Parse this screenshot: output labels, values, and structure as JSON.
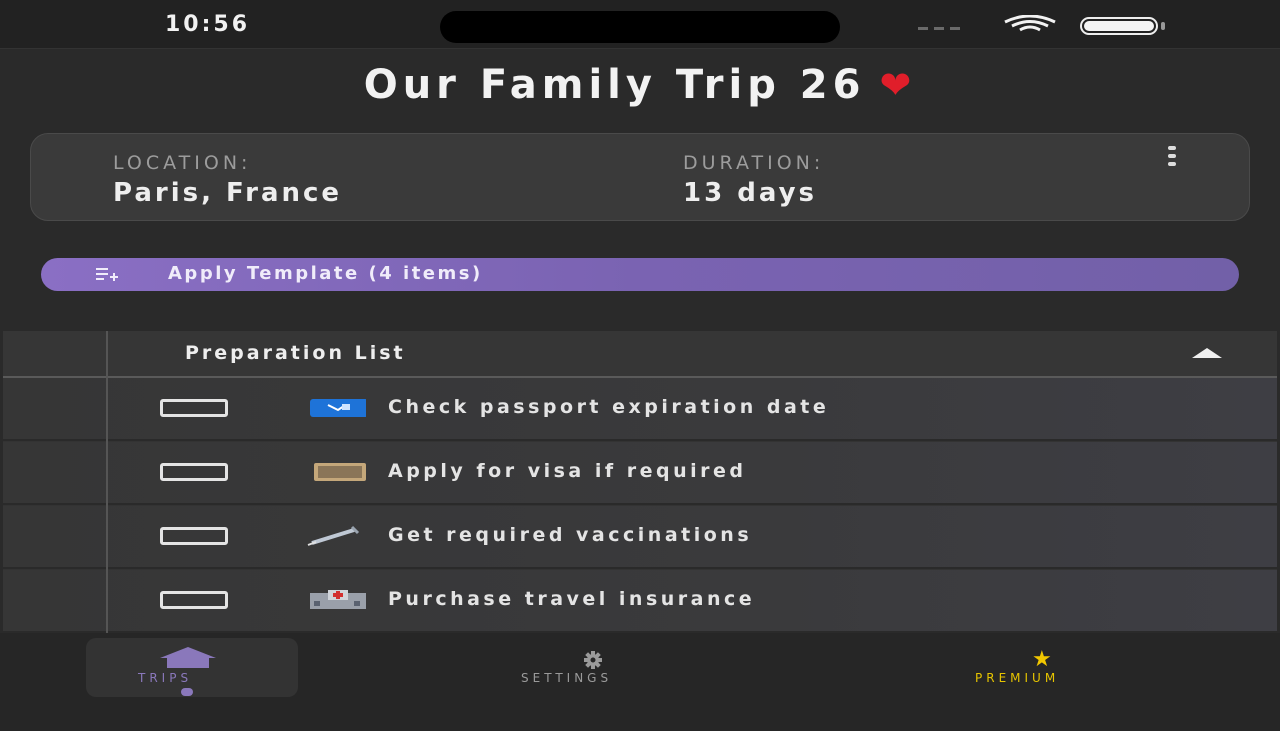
{
  "status_bar": {
    "time": "10:56"
  },
  "trip": {
    "title": "Our Family Trip 26",
    "title_emoji": "heart-icon",
    "location_label": "LOCATION:",
    "location_value": "Paris, France",
    "duration_label": "DURATION:",
    "duration_value": "13 days"
  },
  "template_button": {
    "label": "Apply Template (4 items)",
    "icon": "playlist-add-icon"
  },
  "section": {
    "title": "Preparation List",
    "expanded": true,
    "items": [
      {
        "label": "Check passport expiration date",
        "icon": "passport-icon",
        "checked": false
      },
      {
        "label": "Apply for visa if required",
        "icon": "document-icon",
        "checked": false
      },
      {
        "label": "Get required vaccinations",
        "icon": "syringe-icon",
        "checked": false
      },
      {
        "label": "Purchase travel insurance",
        "icon": "hospital-icon",
        "checked": false
      }
    ]
  },
  "tabs": [
    {
      "label": "TRIPS",
      "icon": "home-icon",
      "active": true
    },
    {
      "label": "SETTINGS",
      "icon": "gear-icon",
      "active": false
    },
    {
      "label": "PREMIUM",
      "icon": "star-icon",
      "active": false
    }
  ],
  "colors": {
    "accent": "#8a6fc4",
    "premium": "#e6c400",
    "heart": "#e01e2a",
    "background": "#2a2a2a"
  }
}
